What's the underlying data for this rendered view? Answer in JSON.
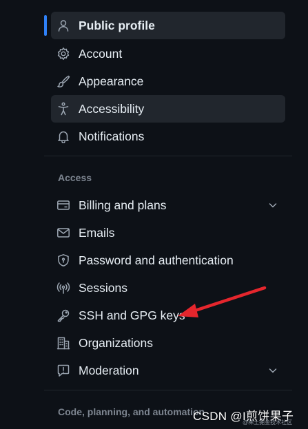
{
  "sidebar": {
    "items": [
      {
        "label": "Public profile",
        "icon": "person-icon",
        "active": true
      },
      {
        "label": "Account",
        "icon": "gear-icon"
      },
      {
        "label": "Appearance",
        "icon": "paintbrush-icon"
      },
      {
        "label": "Accessibility",
        "icon": "accessibility-icon",
        "hovered": true
      },
      {
        "label": "Notifications",
        "icon": "bell-icon"
      }
    ],
    "access_heading": "Access",
    "access_items": [
      {
        "label": "Billing and plans",
        "icon": "credit-card-icon",
        "expandable": true
      },
      {
        "label": "Emails",
        "icon": "mail-icon"
      },
      {
        "label": "Password and authentication",
        "icon": "shield-lock-icon"
      },
      {
        "label": "Sessions",
        "icon": "broadcast-icon"
      },
      {
        "label": "SSH and GPG keys",
        "icon": "key-icon"
      },
      {
        "label": "Organizations",
        "icon": "organization-icon"
      },
      {
        "label": "Moderation",
        "icon": "report-icon",
        "expandable": true
      }
    ],
    "code_heading": "Code, planning, and automation"
  },
  "watermark": {
    "text": "CSDN @I煎饼果子",
    "subtext": "@稀土掘金技术社区"
  },
  "colors": {
    "background": "#0d1117",
    "active_bg": "#21262d",
    "accent": "#2f81f7",
    "text": "#e6edf3",
    "muted": "#7d8590",
    "annotation_arrow": "#e5262d"
  }
}
